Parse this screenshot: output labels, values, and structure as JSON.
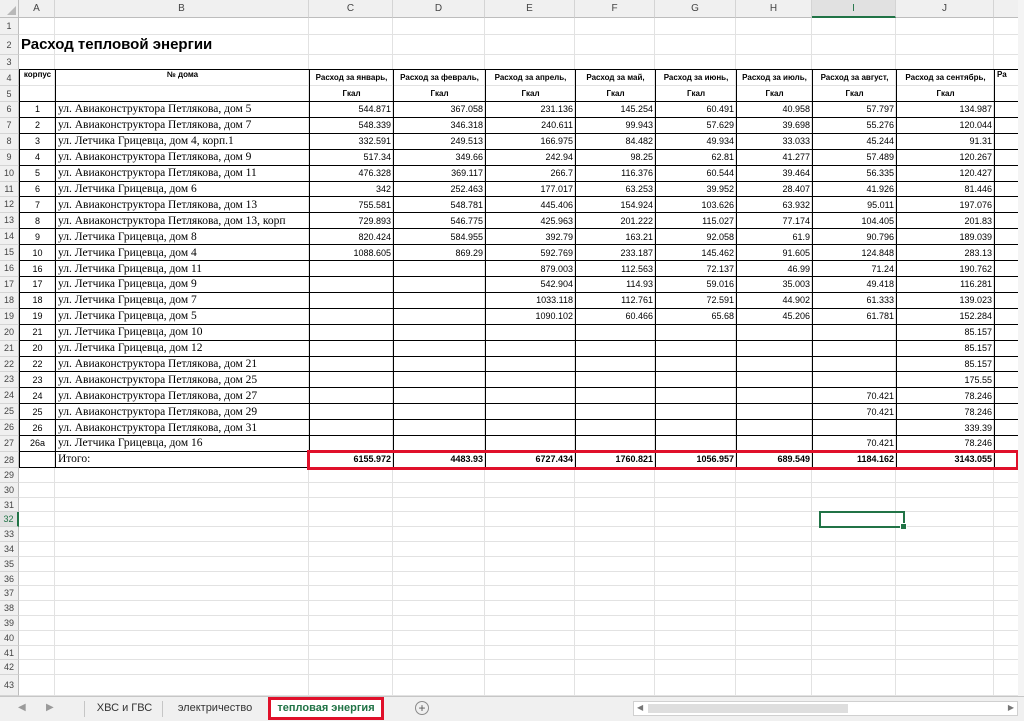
{
  "columns": [
    "A",
    "B",
    "C",
    "D",
    "E",
    "F",
    "G",
    "H",
    "I",
    "J"
  ],
  "active_column": "I",
  "rows_count": 43,
  "active_row": 32,
  "title": "Расход тепловой энергии",
  "headers": {
    "korpus": "корпус",
    "house": "№ дома",
    "months": [
      {
        "top": "Расход за январь,",
        "unit": "Гкал"
      },
      {
        "top": "Расход за февраль,",
        "unit": "Гкал"
      },
      {
        "top": "Расход за апрель,",
        "unit": "Гкал"
      },
      {
        "top": "Расход за май,",
        "unit": "Гкал"
      },
      {
        "top": "Расход за июнь,",
        "unit": "Гкал"
      },
      {
        "top": "Расход за июль,",
        "unit": "Гкал"
      },
      {
        "top": "Расход за август,",
        "unit": "Гкал"
      },
      {
        "top": "Расход за сентябрь,",
        "unit": "Гкал"
      }
    ],
    "partial": "Ра"
  },
  "rows": [
    {
      "korpus": "1",
      "address": "ул. Авиаконструктора Петлякова, дом 5",
      "values": [
        "544.871",
        "367.058",
        "231.136",
        "145.254",
        "60.491",
        "40.958",
        "57.797",
        "134.987"
      ]
    },
    {
      "korpus": "2",
      "address": "ул. Авиаконструктора Петлякова, дом 7",
      "values": [
        "548.339",
        "346.318",
        "240.611",
        "99.943",
        "57.629",
        "39.698",
        "55.276",
        "120.044"
      ]
    },
    {
      "korpus": "3",
      "address": "ул. Летчика Грицевца, дом 4, корп.1",
      "values": [
        "332.591",
        "249.513",
        "166.975",
        "84.482",
        "49.934",
        "33.033",
        "45.244",
        "91.31"
      ]
    },
    {
      "korpus": "4",
      "address": "ул. Авиаконструктора Петлякова, дом 9",
      "values": [
        "517.34",
        "349.66",
        "242.94",
        "98.25",
        "62.81",
        "41.277",
        "57.489",
        "120.267"
      ]
    },
    {
      "korpus": "5",
      "address": "ул. Авиаконструктора Петлякова, дом 11",
      "values": [
        "476.328",
        "369.117",
        "266.7",
        "116.376",
        "60.544",
        "39.464",
        "56.335",
        "120.427"
      ]
    },
    {
      "korpus": "6",
      "address": "ул. Летчика Грицевца, дом 6",
      "values": [
        "342",
        "252.463",
        "177.017",
        "63.253",
        "39.952",
        "28.407",
        "41.926",
        "81.446"
      ]
    },
    {
      "korpus": "7",
      "address": "ул. Авиаконструктора Петлякова, дом 13",
      "values": [
        "755.581",
        "548.781",
        "445.406",
        "154.924",
        "103.626",
        "63.932",
        "95.011",
        "197.076"
      ]
    },
    {
      "korpus": "8",
      "address": "ул. Авиаконструктора Петлякова, дом 13, корп",
      "values": [
        "729.893",
        "546.775",
        "425.963",
        "201.222",
        "115.027",
        "77.174",
        "104.405",
        "201.83"
      ]
    },
    {
      "korpus": "9",
      "address": "ул. Летчика Грицевца, дом 8",
      "values": [
        "820.424",
        "584.955",
        "392.79",
        "163.21",
        "92.058",
        "61.9",
        "90.796",
        "189.039"
      ]
    },
    {
      "korpus": "10",
      "address": "ул. Летчика Грицевца, дом 4",
      "values": [
        "1088.605",
        "869.29",
        "592.769",
        "233.187",
        "145.462",
        "91.605",
        "124.848",
        "283.13"
      ]
    },
    {
      "korpus": "16",
      "address": "ул. Летчика Грицевца, дом 11",
      "values": [
        "",
        "",
        "879.003",
        "112.563",
        "72.137",
        "46.99",
        "71.24",
        "190.762"
      ]
    },
    {
      "korpus": "17",
      "address": "ул. Летчика Грицевца, дом 9",
      "values": [
        "",
        "",
        "542.904",
        "114.93",
        "59.016",
        "35.003",
        "49.418",
        "116.281"
      ]
    },
    {
      "korpus": "18",
      "address": "ул. Летчика Грицевца, дом 7",
      "values": [
        "",
        "",
        "1033.118",
        "112.761",
        "72.591",
        "44.902",
        "61.333",
        "139.023"
      ]
    },
    {
      "korpus": "19",
      "address": "ул. Летчика Грицевца, дом 5",
      "values": [
        "",
        "",
        "1090.102",
        "60.466",
        "65.68",
        "45.206",
        "61.781",
        "152.284"
      ]
    },
    {
      "korpus": "21",
      "address": "ул. Летчика Грицевца, дом 10",
      "values": [
        "",
        "",
        "",
        "",
        "",
        "",
        "",
        "85.157"
      ]
    },
    {
      "korpus": "20",
      "address": "ул. Летчика Грицевца, дом 12",
      "values": [
        "",
        "",
        "",
        "",
        "",
        "",
        "",
        "85.157"
      ]
    },
    {
      "korpus": "22",
      "address": "ул. Авиаконструктора Петлякова, дом 21",
      "values": [
        "",
        "",
        "",
        "",
        "",
        "",
        "",
        "85.157"
      ]
    },
    {
      "korpus": "23",
      "address": "ул. Авиаконструктора Петлякова, дом 25",
      "values": [
        "",
        "",
        "",
        "",
        "",
        "",
        "",
        "175.55"
      ]
    },
    {
      "korpus": "24",
      "address": "ул. Авиаконструктора Петлякова, дом 27",
      "values": [
        "",
        "",
        "",
        "",
        "",
        "",
        "70.421",
        "78.246"
      ]
    },
    {
      "korpus": "25",
      "address": "ул. Авиаконструктора Петлякова, дом 29",
      "values": [
        "",
        "",
        "",
        "",
        "",
        "",
        "70.421",
        "78.246"
      ]
    },
    {
      "korpus": "26",
      "address": "ул. Авиаконструктора Петлякова, дом 31",
      "values": [
        "",
        "",
        "",
        "",
        "",
        "",
        "",
        "339.39"
      ]
    },
    {
      "korpus": "26а",
      "address": "ул. Летчика Грицевца, дом 16",
      "values": [
        "",
        "",
        "",
        "",
        "",
        "",
        "70.421",
        "78.246"
      ]
    }
  ],
  "total": {
    "label": "Итого:",
    "values": [
      "6155.972",
      "4483.93",
      "6727.434",
      "1760.821",
      "1056.957",
      "689.549",
      "1184.162",
      "3143.055"
    ]
  },
  "tabs": {
    "items": [
      {
        "label": "ХВС и ГВС",
        "active": false
      },
      {
        "label": "электричество",
        "active": false
      },
      {
        "label": "тепловая энергия",
        "active": true
      }
    ],
    "add_label": "+",
    "nav_prev": "◀",
    "nav_next": "▶",
    "scroll_left": "◀",
    "scroll_right": "▶"
  },
  "colors": {
    "accent": "#217346",
    "highlight": "#e0102a"
  }
}
